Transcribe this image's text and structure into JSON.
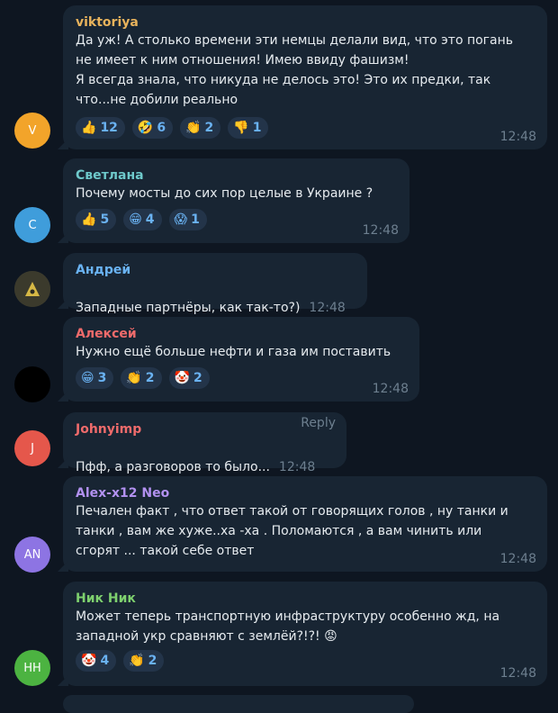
{
  "messages": [
    {
      "name": "viktoriya",
      "name_color": "#e8b35c",
      "avatar_letter": "V",
      "avatar_color": "#f2a42a",
      "text": "Да уж! А столько времени эти немцы делали вид, что это погань\nне имеет к ним отношения! Имею ввиду фашизм!\nЯ всегда знала, что никуда не делось это! Это их предки, так\nчто...не добили реально",
      "reactions": [
        {
          "icon": "thumbs-up",
          "emoji": "👍",
          "count": "12"
        },
        {
          "icon": "rofl",
          "emoji": "🤣",
          "count": "6"
        },
        {
          "icon": "clap",
          "emoji": "👏",
          "count": "2"
        },
        {
          "icon": "thumbs-down",
          "emoji": "👎",
          "count": "1"
        }
      ],
      "time": "12:48"
    },
    {
      "name": "Светлана",
      "name_color": "#6ec9cb",
      "avatar_letter": "C",
      "avatar_color": "#3f9ddb",
      "text": "Почему мосты до сих пор целые в Украине  ?",
      "reactions": [
        {
          "icon": "thumbs-up",
          "emoji": "👍",
          "count": "5"
        },
        {
          "icon": "grin",
          "emoji": "😁",
          "count": "4"
        },
        {
          "icon": "scream",
          "emoji": "😱",
          "count": "1"
        }
      ],
      "time": "12:48"
    },
    {
      "name": "Андрей",
      "name_color": "#6ab3f3",
      "avatar_letter": "",
      "avatar_color": "#3a3a30",
      "avatar_icon": "radiation-icon",
      "text": "Западные партнёры, как так-то?)",
      "reactions": [],
      "time": "12:48"
    },
    {
      "name": "Алексей",
      "name_color": "#ef6b6b",
      "avatar_letter": "",
      "avatar_color": "#000000",
      "text": "Нужно ещё больше нефти и газа им поставить",
      "reactions": [
        {
          "icon": "grin",
          "emoji": "😁",
          "count": "3"
        },
        {
          "icon": "clap",
          "emoji": "👏",
          "count": "2"
        },
        {
          "icon": "clown",
          "emoji": "🤡",
          "count": "2"
        }
      ],
      "time": "12:48"
    },
    {
      "name": "Johnyimp",
      "name_color": "#ef6b6b",
      "avatar_letter": "J",
      "avatar_color": "#e5574b",
      "reply_label": "Reply",
      "text": "Пфф,  а разговоров то было...",
      "reactions": [],
      "time": "12:48"
    },
    {
      "name": "Alex-x12 Neo",
      "name_color": "#b291f0",
      "avatar_letter": "AN",
      "avatar_color": "#8d74e3",
      "text": "Печален факт , что ответ такой от говорящих голов , ну танки и\nтанки , вам же хуже..ха -ха . Поломаются  , а вам чинить или\nсгорят ... такой себе ответ",
      "reactions": [],
      "time": "12:48"
    },
    {
      "name": "Ник Ник",
      "name_color": "#7ed06e",
      "avatar_letter": "НН",
      "avatar_color": "#4cb341",
      "text": "Может теперь транспортную  инфраструктуру особенно жд, на\nзападной укр сравняют с землёй?!?! 😡",
      "reactions": [
        {
          "icon": "clown",
          "emoji": "🤡",
          "count": "4"
        },
        {
          "icon": "clap",
          "emoji": "👏",
          "count": "2"
        }
      ],
      "time": "12:48"
    }
  ]
}
